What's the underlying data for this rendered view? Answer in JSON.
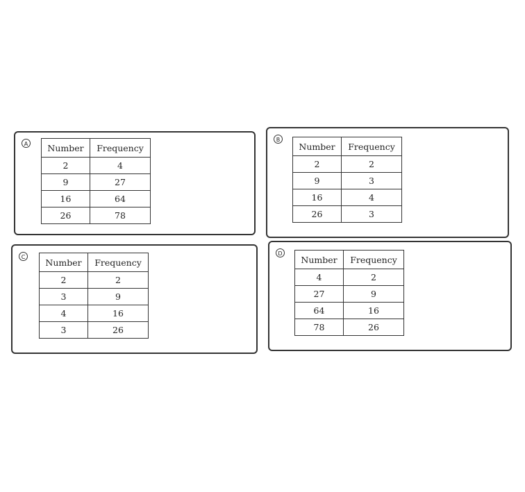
{
  "options": [
    {
      "letter": "A",
      "headers": [
        "Number",
        "Frequency"
      ],
      "rows": [
        [
          "2",
          "4"
        ],
        [
          "9",
          "27"
        ],
        [
          "16",
          "64"
        ],
        [
          "26",
          "78"
        ]
      ]
    },
    {
      "letter": "B",
      "headers": [
        "Number",
        "Frequency"
      ],
      "rows": [
        [
          "2",
          "2"
        ],
        [
          "9",
          "3"
        ],
        [
          "16",
          "4"
        ],
        [
          "26",
          "3"
        ]
      ]
    },
    {
      "letter": "C",
      "headers": [
        "Number",
        "Frequency"
      ],
      "rows": [
        [
          "2",
          "2"
        ],
        [
          "3",
          "9"
        ],
        [
          "4",
          "16"
        ],
        [
          "3",
          "26"
        ]
      ]
    },
    {
      "letter": "D",
      "headers": [
        "Number",
        "Frequency"
      ],
      "rows": [
        [
          "4",
          "2"
        ],
        [
          "27",
          "9"
        ],
        [
          "64",
          "16"
        ],
        [
          "78",
          "26"
        ]
      ]
    }
  ]
}
